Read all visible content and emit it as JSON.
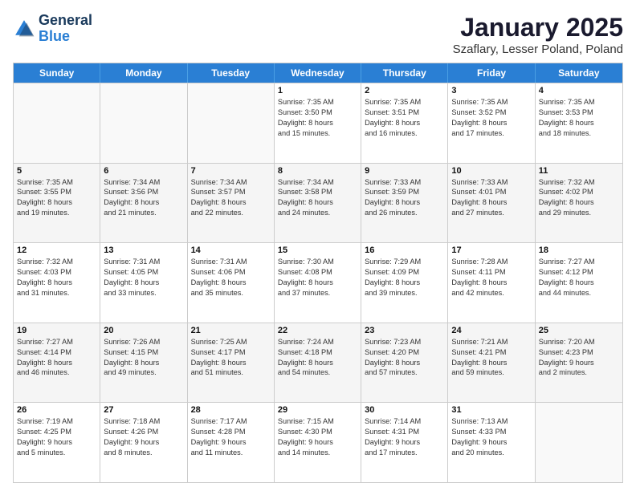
{
  "logo": {
    "line1": "General",
    "line2": "Blue"
  },
  "title": "January 2025",
  "subtitle": "Szaflary, Lesser Poland, Poland",
  "weekdays": [
    "Sunday",
    "Monday",
    "Tuesday",
    "Wednesday",
    "Thursday",
    "Friday",
    "Saturday"
  ],
  "rows": [
    [
      {
        "day": "",
        "lines": []
      },
      {
        "day": "",
        "lines": []
      },
      {
        "day": "",
        "lines": []
      },
      {
        "day": "1",
        "lines": [
          "Sunrise: 7:35 AM",
          "Sunset: 3:50 PM",
          "Daylight: 8 hours",
          "and 15 minutes."
        ]
      },
      {
        "day": "2",
        "lines": [
          "Sunrise: 7:35 AM",
          "Sunset: 3:51 PM",
          "Daylight: 8 hours",
          "and 16 minutes."
        ]
      },
      {
        "day": "3",
        "lines": [
          "Sunrise: 7:35 AM",
          "Sunset: 3:52 PM",
          "Daylight: 8 hours",
          "and 17 minutes."
        ]
      },
      {
        "day": "4",
        "lines": [
          "Sunrise: 7:35 AM",
          "Sunset: 3:53 PM",
          "Daylight: 8 hours",
          "and 18 minutes."
        ]
      }
    ],
    [
      {
        "day": "5",
        "lines": [
          "Sunrise: 7:35 AM",
          "Sunset: 3:55 PM",
          "Daylight: 8 hours",
          "and 19 minutes."
        ]
      },
      {
        "day": "6",
        "lines": [
          "Sunrise: 7:34 AM",
          "Sunset: 3:56 PM",
          "Daylight: 8 hours",
          "and 21 minutes."
        ]
      },
      {
        "day": "7",
        "lines": [
          "Sunrise: 7:34 AM",
          "Sunset: 3:57 PM",
          "Daylight: 8 hours",
          "and 22 minutes."
        ]
      },
      {
        "day": "8",
        "lines": [
          "Sunrise: 7:34 AM",
          "Sunset: 3:58 PM",
          "Daylight: 8 hours",
          "and 24 minutes."
        ]
      },
      {
        "day": "9",
        "lines": [
          "Sunrise: 7:33 AM",
          "Sunset: 3:59 PM",
          "Daylight: 8 hours",
          "and 26 minutes."
        ]
      },
      {
        "day": "10",
        "lines": [
          "Sunrise: 7:33 AM",
          "Sunset: 4:01 PM",
          "Daylight: 8 hours",
          "and 27 minutes."
        ]
      },
      {
        "day": "11",
        "lines": [
          "Sunrise: 7:32 AM",
          "Sunset: 4:02 PM",
          "Daylight: 8 hours",
          "and 29 minutes."
        ]
      }
    ],
    [
      {
        "day": "12",
        "lines": [
          "Sunrise: 7:32 AM",
          "Sunset: 4:03 PM",
          "Daylight: 8 hours",
          "and 31 minutes."
        ]
      },
      {
        "day": "13",
        "lines": [
          "Sunrise: 7:31 AM",
          "Sunset: 4:05 PM",
          "Daylight: 8 hours",
          "and 33 minutes."
        ]
      },
      {
        "day": "14",
        "lines": [
          "Sunrise: 7:31 AM",
          "Sunset: 4:06 PM",
          "Daylight: 8 hours",
          "and 35 minutes."
        ]
      },
      {
        "day": "15",
        "lines": [
          "Sunrise: 7:30 AM",
          "Sunset: 4:08 PM",
          "Daylight: 8 hours",
          "and 37 minutes."
        ]
      },
      {
        "day": "16",
        "lines": [
          "Sunrise: 7:29 AM",
          "Sunset: 4:09 PM",
          "Daylight: 8 hours",
          "and 39 minutes."
        ]
      },
      {
        "day": "17",
        "lines": [
          "Sunrise: 7:28 AM",
          "Sunset: 4:11 PM",
          "Daylight: 8 hours",
          "and 42 minutes."
        ]
      },
      {
        "day": "18",
        "lines": [
          "Sunrise: 7:27 AM",
          "Sunset: 4:12 PM",
          "Daylight: 8 hours",
          "and 44 minutes."
        ]
      }
    ],
    [
      {
        "day": "19",
        "lines": [
          "Sunrise: 7:27 AM",
          "Sunset: 4:14 PM",
          "Daylight: 8 hours",
          "and 46 minutes."
        ]
      },
      {
        "day": "20",
        "lines": [
          "Sunrise: 7:26 AM",
          "Sunset: 4:15 PM",
          "Daylight: 8 hours",
          "and 49 minutes."
        ]
      },
      {
        "day": "21",
        "lines": [
          "Sunrise: 7:25 AM",
          "Sunset: 4:17 PM",
          "Daylight: 8 hours",
          "and 51 minutes."
        ]
      },
      {
        "day": "22",
        "lines": [
          "Sunrise: 7:24 AM",
          "Sunset: 4:18 PM",
          "Daylight: 8 hours",
          "and 54 minutes."
        ]
      },
      {
        "day": "23",
        "lines": [
          "Sunrise: 7:23 AM",
          "Sunset: 4:20 PM",
          "Daylight: 8 hours",
          "and 57 minutes."
        ]
      },
      {
        "day": "24",
        "lines": [
          "Sunrise: 7:21 AM",
          "Sunset: 4:21 PM",
          "Daylight: 8 hours",
          "and 59 minutes."
        ]
      },
      {
        "day": "25",
        "lines": [
          "Sunrise: 7:20 AM",
          "Sunset: 4:23 PM",
          "Daylight: 9 hours",
          "and 2 minutes."
        ]
      }
    ],
    [
      {
        "day": "26",
        "lines": [
          "Sunrise: 7:19 AM",
          "Sunset: 4:25 PM",
          "Daylight: 9 hours",
          "and 5 minutes."
        ]
      },
      {
        "day": "27",
        "lines": [
          "Sunrise: 7:18 AM",
          "Sunset: 4:26 PM",
          "Daylight: 9 hours",
          "and 8 minutes."
        ]
      },
      {
        "day": "28",
        "lines": [
          "Sunrise: 7:17 AM",
          "Sunset: 4:28 PM",
          "Daylight: 9 hours",
          "and 11 minutes."
        ]
      },
      {
        "day": "29",
        "lines": [
          "Sunrise: 7:15 AM",
          "Sunset: 4:30 PM",
          "Daylight: 9 hours",
          "and 14 minutes."
        ]
      },
      {
        "day": "30",
        "lines": [
          "Sunrise: 7:14 AM",
          "Sunset: 4:31 PM",
          "Daylight: 9 hours",
          "and 17 minutes."
        ]
      },
      {
        "day": "31",
        "lines": [
          "Sunrise: 7:13 AM",
          "Sunset: 4:33 PM",
          "Daylight: 9 hours",
          "and 20 minutes."
        ]
      },
      {
        "day": "",
        "lines": []
      }
    ]
  ]
}
